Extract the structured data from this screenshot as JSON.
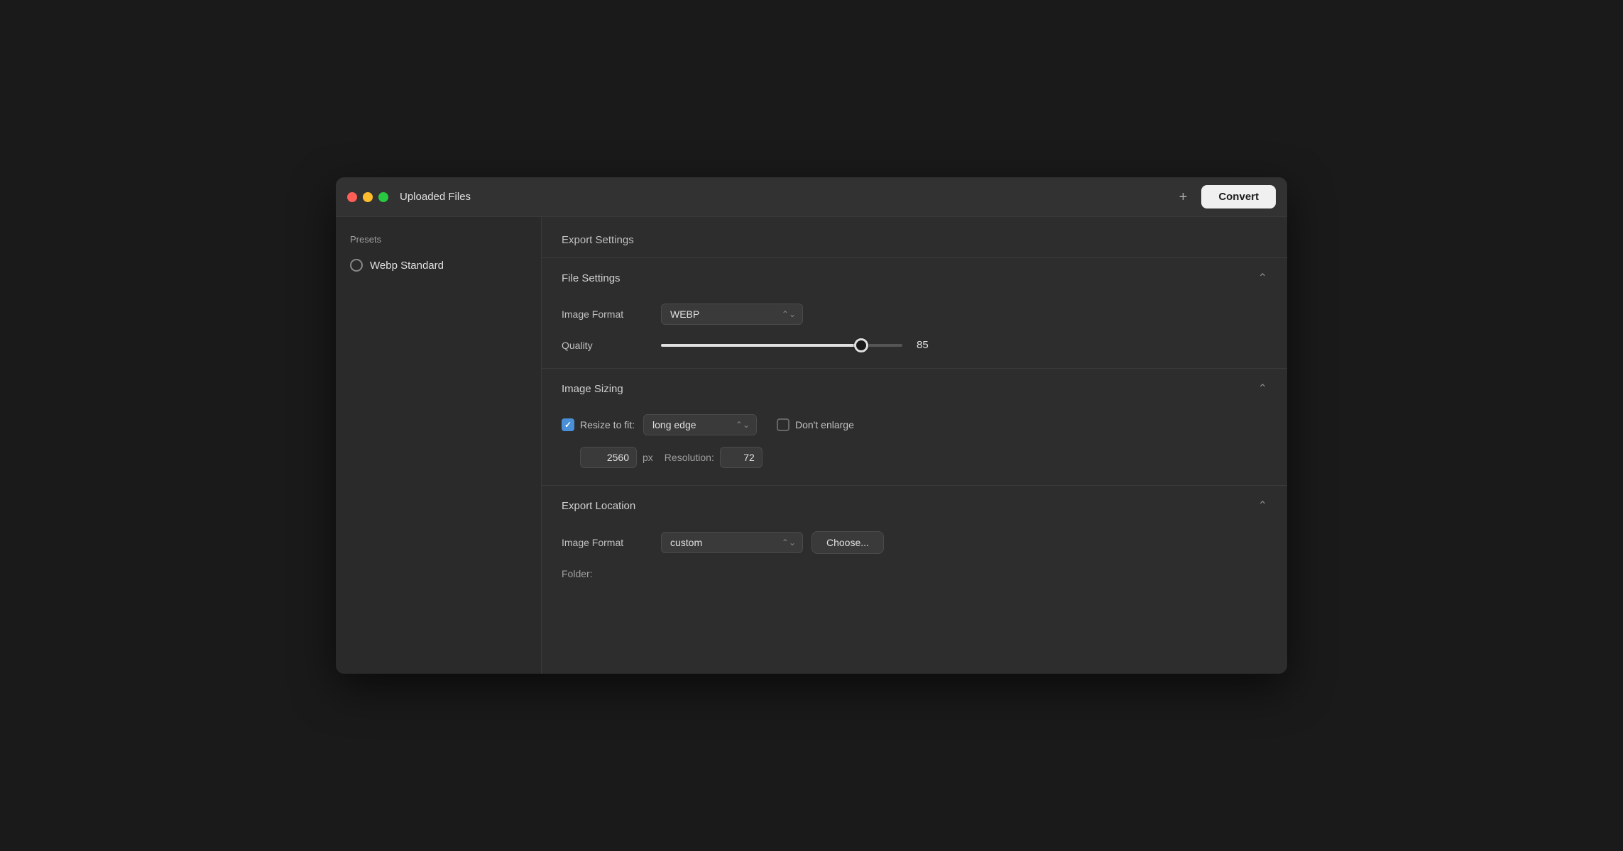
{
  "window": {
    "title": "Uploaded Files"
  },
  "titlebar": {
    "plus_label": "+",
    "convert_label": "Convert"
  },
  "sidebar": {
    "title": "Presets",
    "presets": [
      {
        "label": "Webp Standard",
        "selected": false
      }
    ]
  },
  "main": {
    "export_settings_label": "Export Settings",
    "file_settings": {
      "section_label": "File Settings",
      "image_format_label": "Image Format",
      "image_format_value": "WEBP",
      "quality_label": "Quality",
      "quality_value": 85,
      "quality_percent": 85
    },
    "image_sizing": {
      "section_label": "Image Sizing",
      "resize_label": "Resize to fit:",
      "resize_checked": true,
      "resize_fit_value": "long edge",
      "dont_enlarge_label": "Don't enlarge",
      "dont_enlarge_checked": false,
      "dimension_value": "2560",
      "dimension_unit": "px",
      "resolution_label": "Resolution:",
      "resolution_value": "72"
    },
    "export_location": {
      "section_label": "Export Location",
      "location_label": "Image Format",
      "location_value": "custom",
      "choose_label": "Choose...",
      "folder_label": "Folder:"
    }
  }
}
